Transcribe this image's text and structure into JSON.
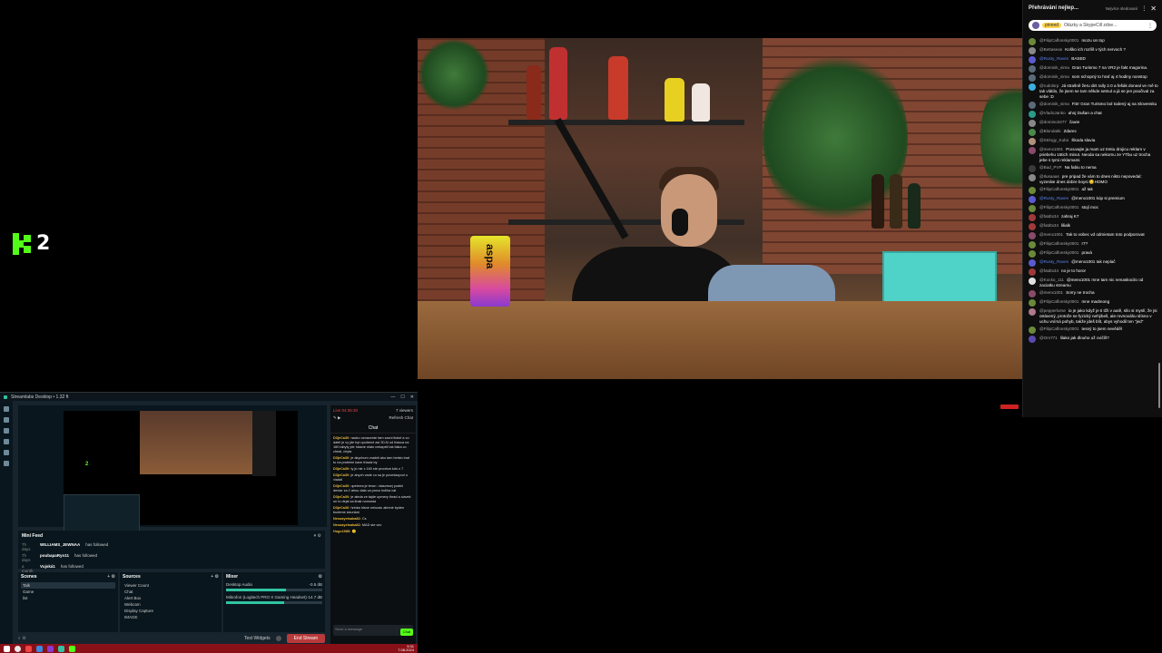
{
  "brand": {
    "logo_text": "2",
    "accent": "#53fc18"
  },
  "yt_chat": {
    "title": "Přehrávání nejlep...",
    "badge": "Nejvíce sledovaní",
    "pinned_chip": "pinned",
    "pinned_text": "Otázky a SkypeCill zdoe...",
    "messages": [
      {
        "author": "@FilipCaflonsky0001",
        "text": "mozu on top",
        "color": "#6a8a3a"
      },
      {
        "author": "@Bettaseas",
        "text": "Koško ich rozlíš v tých nervoch ?",
        "color": "#888"
      },
      {
        "author": "@Rusty_Raven",
        "text": "BASED",
        "color": "#5a5ad0",
        "mod": true
      },
      {
        "author": "@dominik_sima",
        "text": "Gran Turismo 7 na VR2 je fakt magorina.",
        "color": "#5a6a7a"
      },
      {
        "author": "@dominik_sima",
        "text": "som schopný to hrať aj 4 hodiny nonstop",
        "color": "#5a6a7a"
      },
      {
        "author": "@rudolsrp",
        "text": "Já strašně žeru dirt rally 2.0 a fešák doneal ve mě to tak vlátilo, že jsem se tam někde setnul a já se jen poučival za sebe :D",
        "color": "#3ab0e0"
      },
      {
        "author": "@dominik_sima",
        "text": "Fitrr Gran Turismo bol todený aj na Slovensku",
        "color": "#5a6a7a"
      },
      {
        "author": "@VladoJanko",
        "text": "ahoj Dušan a chat",
        "color": "#2a9a8a"
      },
      {
        "author": "@domino3477",
        "text": "čaute",
        "color": "#888"
      },
      {
        "author": "@Blondakk",
        "text": "Zdarec",
        "color": "#4a8a4a"
      },
      {
        "author": "@Stringy_Kubo",
        "text": "Škoda slavia",
        "color": "#b0907a"
      },
      {
        "author": "@menx1001",
        "text": "Pocuvajte ja mam uz tretiu drojicu reklam v priebehu 15tich minut. Neoda sa nekomu ze YTbu uz trocha jebe s tymi reklamami",
        "color": "#8a4a6a"
      },
      {
        "author": "@Bad_PVP",
        "text": "Na fabiu to nema",
        "color": "#3a3a3a"
      },
      {
        "author": "@Ilusaaas",
        "text": "pre pripad že vám to dnes nikto nepovedal: vyzeráte dnes dobre boysi 🙂HOMO",
        "color": "#888"
      },
      {
        "author": "@FilipCaflonsky0001",
        "text": "až tak",
        "color": "#6a8a3a"
      },
      {
        "author": "@Rusty_Raven",
        "text": "@menx1001 kúp si premium",
        "color": "#5a5ad0",
        "mod": true
      },
      {
        "author": "@FilipCaflonsky0001",
        "text": "stojí moc",
        "color": "#6a8a3a"
      },
      {
        "author": "@fatdtx34",
        "text": "zahraj K7",
        "color": "#a03a3a"
      },
      {
        "author": "@fatdtx34",
        "text": "lilialk",
        "color": "#a03a3a"
      },
      {
        "author": "@menx1001",
        "text": "Tak to vobec vd odmietam toto podporovat",
        "color": "#8a4a6a"
      },
      {
        "author": "@FilipCaflonsky0001",
        "text": "r7?",
        "color": "#6a8a3a"
      },
      {
        "author": "@FilipCaflonsky0001",
        "text": "pravá",
        "color": "#6a8a3a"
      },
      {
        "author": "@Rusty_Raven",
        "text": "@menx1001 tak neplač",
        "color": "#5a5ad0",
        "mod": true
      },
      {
        "author": "@fatdtx34",
        "text": "no je to horor",
        "color": "#a03a3a"
      },
      {
        "author": "@Kocko_111",
        "text": "@menx1001 mne tam nic nenaskocilo od zaciatku streamu",
        "color": "#e0e0e0"
      },
      {
        "author": "@menx1001",
        "text": "Sorry ne trocha",
        "color": "#8a4a6a"
      },
      {
        "author": "@FilipCaflonsky0001",
        "text": "mne madmong",
        "color": "#6a8a3a"
      },
      {
        "author": "@pepperlurse",
        "text": "io je jako když je ti tíži v autě, sílo si myslí, že jsi otrávený, protože se fyzický nehýbeš, ale rovnováhu slísno v uchu vnímá pohyb, takže jdeš blít, abys vyhodil ten \"jed\"",
        "color": "#b07a8a"
      },
      {
        "author": "@FilipCaflonsky0001",
        "text": "tesný to jsem nevěděl",
        "color": "#6a8a3a"
      },
      {
        "author": "@Om771",
        "text": "lilako jak dlouho už cvičíš?",
        "color": "#5a4ab0"
      }
    ]
  },
  "video": {
    "can_label": "aspa"
  },
  "streamlabs": {
    "title": "Streamlabs Desktop • 1.32 ft",
    "mini_feed_title": "Mini Feed",
    "feed": [
      {
        "ago": "7h days",
        "user": "WILLIAMS_JEWNAA",
        "action": "has followed"
      },
      {
        "ago": "7h days",
        "user": "poubapaRyn11",
        "action": "has followed"
      },
      {
        "ago": "a month",
        "user": "Vujská1",
        "action": "has followed"
      }
    ],
    "scenes_title": "Scenes",
    "scenes": [
      "Talk",
      "Game",
      "list"
    ],
    "sources_title": "Sources",
    "sources": [
      "Viewer Count",
      "Chat",
      "Alert Box",
      "Webcam",
      "Display Capture",
      "IMAGE"
    ],
    "mixer_title": "Mixer",
    "mixer": [
      {
        "name": "Desktop Audio",
        "level": "-0.5 dB",
        "fill": 0.62
      },
      {
        "name": "Mikrofon (Logitech PRO X Gaming Headset)",
        "level": "-14.7 dB",
        "fill": 0.6
      }
    ],
    "test_widgets": "Test Widgets",
    "go_live": "End Stream",
    "chat_live": "Live 04:35:30",
    "chat_viewers": "7 viewers",
    "chat_title": "Chat",
    "refresh_chat": "Refresh Chat",
    "chat_lines": [
      {
        "nm": "D3jeCa30:",
        "tx": "nacko oznacente tam zacni tlokel a co datel je vy jde byt upotrené asi 30 Al od hlasca na 160 tabyty jde hlasne nlato nekapeli tak tlaka co cheal, chyta"
      },
      {
        "nm": "D3jeCa30:",
        "tx": "je akychom vradeli ako tam beisto bral tu na proteine kaxe friaalz by"
      },
      {
        "nm": "D3jeCa30:",
        "tx": "ty jú nie x 160 ste proobva kdo o 7"
      },
      {
        "nm": "D3jeCa30:",
        "tx": "je ahych vade co sa je povedacpod u viadal"
      },
      {
        "nm": "D3jeCa30:",
        "tx": "upetrrea je tenw:: olasvesej podrki deniar za 2 ahuu dala va proxo bolika vat"
      },
      {
        "nm": "D3jeCa30:",
        "tx": "je aleda ze tajde upmery thrad a ciavek on to dejal za linak nomosta"
      },
      {
        "nm": "D3jeCa30:",
        "tx": "hrinka hlsne nelozdu akhmé byden budeme sizunkat"
      },
      {
        "nm": "Nesuayetsaka82:",
        "tx": "Cs"
      },
      {
        "nm": "Nesuayetsaka82:",
        "tx": "MAD ste vec"
      },
      {
        "nm": "Hugo1985:",
        "tx": "🙂"
      }
    ],
    "chat_placeholder": "Send a message"
  },
  "taskbar": {
    "time": "9:31",
    "date": "7.08.2024"
  }
}
